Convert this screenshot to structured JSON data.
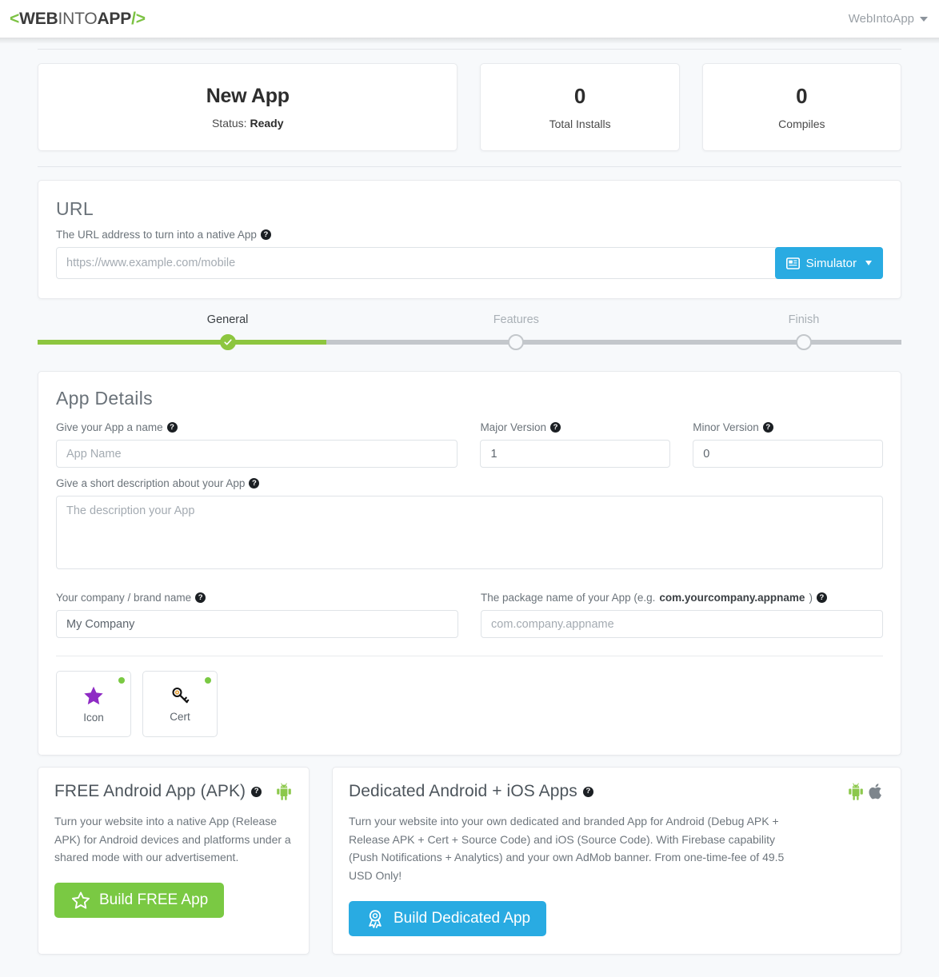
{
  "header": {
    "logo_bracket_open": "<",
    "logo_web": "WEB",
    "logo_into": "INTO",
    "logo_app": "APP",
    "logo_bracket_close": "/>",
    "user_name": "WebIntoApp",
    "caret_icon": "chevron-down-icon"
  },
  "stats": {
    "app_name": "New App",
    "status_prefix": "Status:",
    "status_value": "Ready",
    "installs_value": "0",
    "installs_label": "Total Installs",
    "compiles_value": "0",
    "compiles_label": "Compiles"
  },
  "url_panel": {
    "title": "URL",
    "label": "The URL address to turn into a native App",
    "help_glyph": "?",
    "input_placeholder": "https://www.example.com/mobile",
    "input_value": "",
    "simulator_label": "Simulator",
    "simulator_icon": "simulator-screen-icon",
    "accent_color": "#29abe2"
  },
  "stepper": {
    "steps": [
      {
        "label": "General",
        "state": "done",
        "pos_pct": 22
      },
      {
        "label": "Features",
        "state": "todo",
        "pos_pct": 55.4
      },
      {
        "label": "Finish",
        "state": "todo",
        "pos_pct": 88.7
      }
    ],
    "fill_pct": 33.4,
    "fill_color": "#8dc63f",
    "track_color": "#c3c7cb"
  },
  "app_details": {
    "title": "App Details",
    "name_label": "Give your App a name",
    "name_placeholder": "App Name",
    "name_value": "",
    "major_label": "Major Version",
    "major_value": "1",
    "minor_label": "Minor Version",
    "minor_value": "0",
    "description_label": "Give a short description about your App",
    "description_placeholder": "The description your App",
    "description_value": "",
    "company_label": "Your company / brand name",
    "company_value": "My Company",
    "package_label_pre": "The package name of your App (e.g. ",
    "package_label_bold": "com.yourcompany.appname",
    "package_label_post": ")",
    "package_placeholder": "com.company.appname",
    "package_value": "",
    "tiles": [
      {
        "label": "Icon",
        "icon": "star-icon",
        "status_color": "#7ac943"
      },
      {
        "label": "Cert",
        "icon": "key-icon",
        "status_color": "#7ac943"
      }
    ]
  },
  "promos": {
    "free": {
      "title": "FREE Android App (APK)",
      "icon": "android-icon",
      "body": "Turn your website into a native App (Release APK) for Android devices and platforms under a shared mode with our advertisement.",
      "button_label": "Build FREE App",
      "button_icon": "star-outline-icon",
      "button_color": "#7ac943"
    },
    "dedicated": {
      "title": "Dedicated Android + iOS Apps",
      "icons": [
        "android-icon",
        "apple-icon"
      ],
      "body": "Turn your website into your own dedicated and branded App for Android (Debug APK + Release APK + Cert + Source Code) and iOS (Source Code). With Firebase capability (Push Notifications + Analytics) and your own AdMob banner. From one-time-fee of 49.5 USD Only!",
      "button_label": "Build Dedicated App",
      "button_icon": "award-ribbon-icon",
      "button_color": "#29abe2"
    }
  }
}
